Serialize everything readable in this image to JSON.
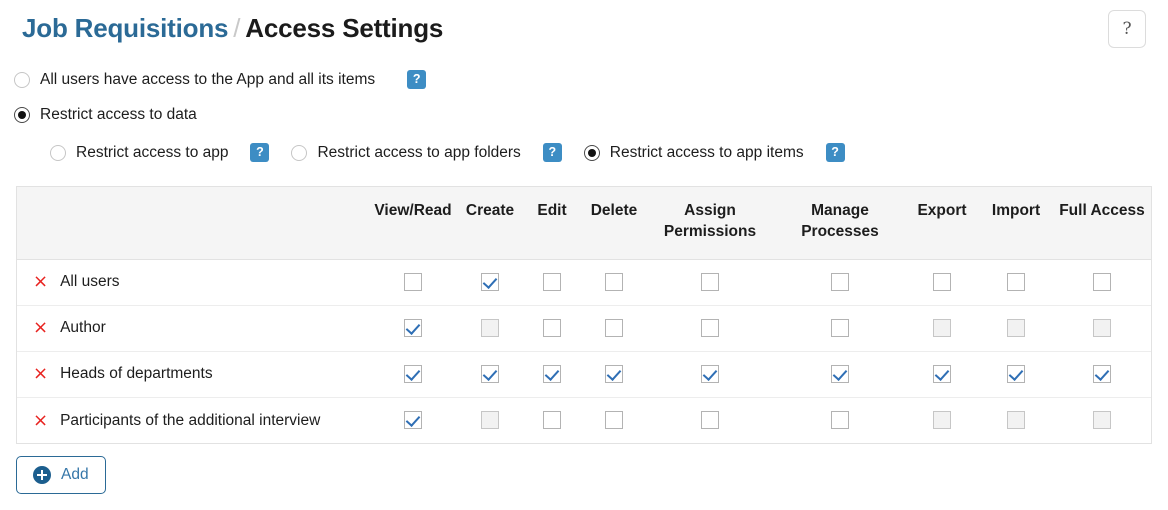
{
  "header": {
    "app_name": "Job Requisitions",
    "separator": "/",
    "page_title": "Access Settings",
    "help_button_glyph": "?",
    "help_button_icon": "question-mark-icon"
  },
  "access_mode": {
    "options": [
      {
        "label": "All users have access to the App and all its items",
        "selected": false,
        "hint": "?"
      },
      {
        "label": "Restrict access to data",
        "selected": true,
        "hint": null
      }
    ],
    "sub_options": [
      {
        "label": "Restrict access to app",
        "selected": false,
        "hint": "?"
      },
      {
        "label": "Restrict access to app folders",
        "selected": false,
        "hint": "?"
      },
      {
        "label": "Restrict access to app items",
        "selected": true,
        "hint": "?"
      }
    ]
  },
  "permissions_table": {
    "name_column_header": "",
    "columns": [
      "View/Read",
      "Create",
      "Edit",
      "Delete",
      "Assign Permissions",
      "Manage Processes",
      "Export",
      "Import",
      "Full Access"
    ],
    "rows": [
      {
        "name": "All users",
        "delete_icon": "×",
        "cells": [
          {
            "checked": false,
            "disabled": false
          },
          {
            "checked": true,
            "disabled": false
          },
          {
            "checked": false,
            "disabled": false
          },
          {
            "checked": false,
            "disabled": false
          },
          {
            "checked": false,
            "disabled": false
          },
          {
            "checked": false,
            "disabled": false
          },
          {
            "checked": false,
            "disabled": false
          },
          {
            "checked": false,
            "disabled": false
          },
          {
            "checked": false,
            "disabled": false
          }
        ]
      },
      {
        "name": "Author",
        "delete_icon": "×",
        "cells": [
          {
            "checked": true,
            "disabled": false
          },
          {
            "checked": false,
            "disabled": true
          },
          {
            "checked": false,
            "disabled": false
          },
          {
            "checked": false,
            "disabled": false
          },
          {
            "checked": false,
            "disabled": false
          },
          {
            "checked": false,
            "disabled": false
          },
          {
            "checked": false,
            "disabled": true
          },
          {
            "checked": false,
            "disabled": true
          },
          {
            "checked": false,
            "disabled": true
          }
        ]
      },
      {
        "name": "Heads of departments",
        "delete_icon": "×",
        "cells": [
          {
            "checked": true,
            "disabled": false
          },
          {
            "checked": true,
            "disabled": false
          },
          {
            "checked": true,
            "disabled": false
          },
          {
            "checked": true,
            "disabled": false
          },
          {
            "checked": true,
            "disabled": false
          },
          {
            "checked": true,
            "disabled": false
          },
          {
            "checked": true,
            "disabled": false
          },
          {
            "checked": true,
            "disabled": false
          },
          {
            "checked": true,
            "disabled": false
          }
        ]
      },
      {
        "name": "Participants of the additional interview",
        "delete_icon": "×",
        "cells": [
          {
            "checked": true,
            "disabled": false
          },
          {
            "checked": false,
            "disabled": true
          },
          {
            "checked": false,
            "disabled": false
          },
          {
            "checked": false,
            "disabled": false
          },
          {
            "checked": false,
            "disabled": false
          },
          {
            "checked": false,
            "disabled": false
          },
          {
            "checked": false,
            "disabled": true
          },
          {
            "checked": false,
            "disabled": true
          },
          {
            "checked": false,
            "disabled": true
          }
        ]
      }
    ]
  },
  "add_button": {
    "label": "Add",
    "icon": "plus-circle-icon"
  },
  "colors": {
    "app_link": "#2b6a96",
    "hint_badge": "#3d8dc4",
    "checkmark": "#2f6fb5",
    "delete_x": "#e8221f",
    "header_row_bg": "#f5f5f5",
    "add_button_border": "#2b6a96"
  }
}
